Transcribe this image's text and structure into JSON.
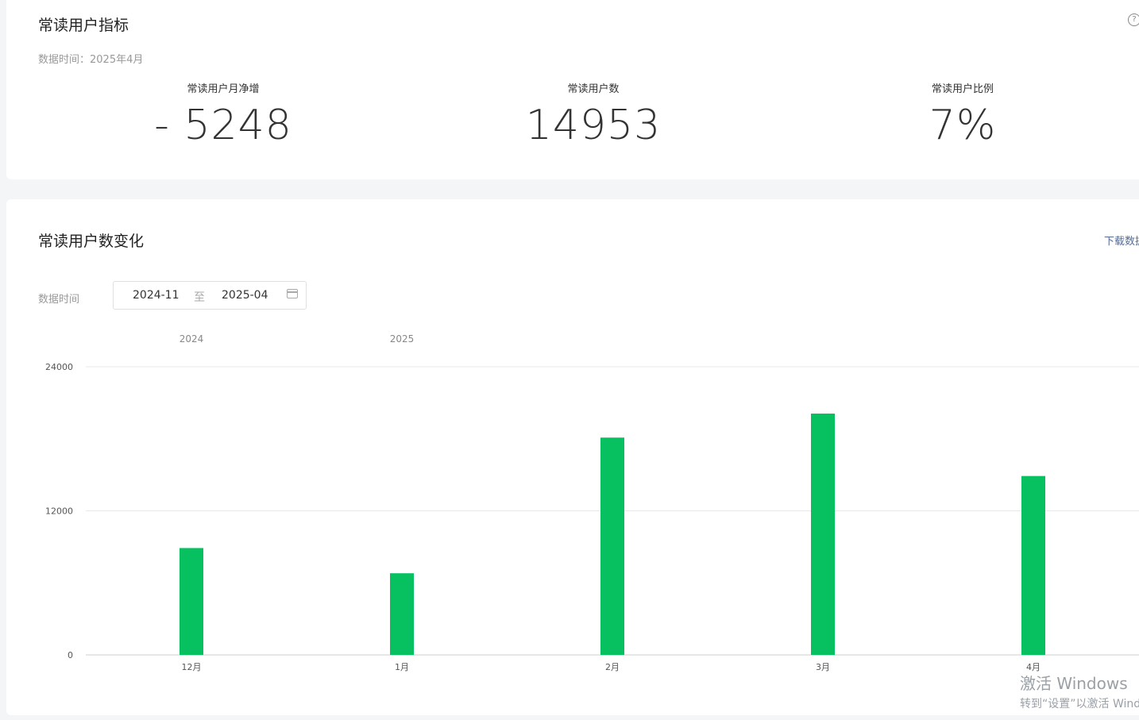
{
  "metrics_card": {
    "title": "常读用户指标",
    "data_time": "数据时间：2025年4月",
    "metrics": [
      {
        "label": "常读用户月净增",
        "value": "- 5248"
      },
      {
        "label": "常读用户数",
        "value": "14953"
      },
      {
        "label": "常读用户比例",
        "value": "7%"
      }
    ]
  },
  "trend_card": {
    "title": "常读用户数变化",
    "download_label": "下载数据",
    "date_label": "数据时间",
    "date_start": "2024-11",
    "date_sep": "至",
    "date_end": "2025-04"
  },
  "chart_data": {
    "type": "bar",
    "year_labels": [
      {
        "year": "2024",
        "category": "12月"
      },
      {
        "year": "2025",
        "category": "1月"
      }
    ],
    "categories": [
      "12月",
      "1月",
      "2月",
      "3月",
      "4月"
    ],
    "values": [
      8900,
      6800,
      18100,
      20100,
      14900
    ],
    "y_ticks": [
      0,
      12000,
      24000
    ],
    "ylim": [
      0,
      24000
    ],
    "grid": true,
    "bar_color": "#07c160"
  },
  "watermark": {
    "line1": "激活 Windows",
    "line2": "转到“设置”以激活 Windows。"
  }
}
